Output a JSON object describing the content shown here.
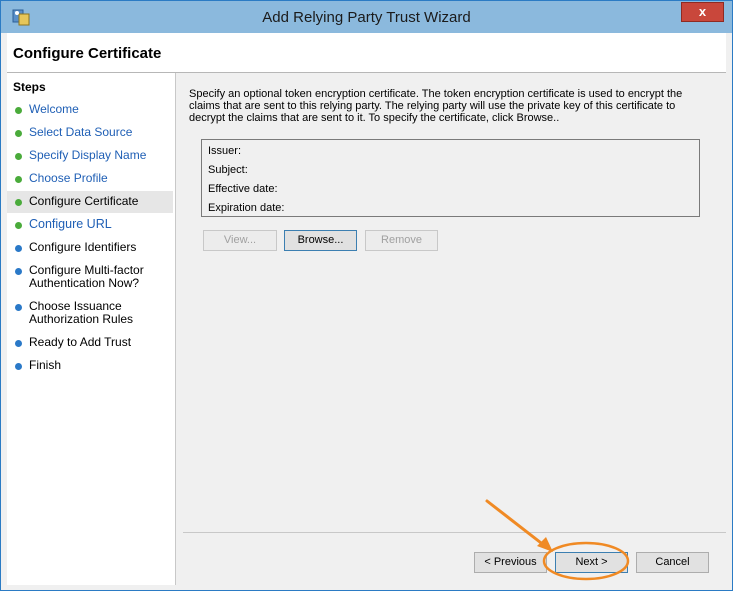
{
  "window": {
    "title": "Add Relying Party Trust Wizard",
    "close_label": "x",
    "icon": "wizard-app-icon"
  },
  "header": {
    "page_title": "Configure Certificate"
  },
  "steps": {
    "title": "Steps",
    "items": [
      {
        "label": "Welcome",
        "status": "complete"
      },
      {
        "label": "Select Data Source",
        "status": "complete"
      },
      {
        "label": "Specify Display Name",
        "status": "complete"
      },
      {
        "label": "Choose Profile",
        "status": "complete"
      },
      {
        "label": "Configure Certificate",
        "status": "current"
      },
      {
        "label": "Configure URL",
        "status": "pending-link"
      },
      {
        "label": "Configure Identifiers",
        "status": "pending"
      },
      {
        "label": "Configure Multi-factor Authentication Now?",
        "status": "pending"
      },
      {
        "label": "Choose Issuance Authorization Rules",
        "status": "pending"
      },
      {
        "label": "Ready to Add Trust",
        "status": "pending"
      },
      {
        "label": "Finish",
        "status": "pending"
      }
    ]
  },
  "content": {
    "description": "Specify an optional token encryption certificate.  The token encryption certificate is used to encrypt the claims that are sent to this relying party.  The relying party will use the private key of this certificate to decrypt the claims that are sent to it.  To specify the certificate, click Browse..",
    "cert_fields": {
      "issuer": "Issuer:",
      "subject": "Subject:",
      "effective_date": "Effective date:",
      "expiration_date": "Expiration date:"
    },
    "buttons": {
      "view": "View...",
      "browse": "Browse...",
      "remove": "Remove"
    }
  },
  "footer": {
    "previous": "< Previous",
    "next": "Next >",
    "cancel": "Cancel"
  },
  "colors": {
    "titlebar": "#8bb9dd",
    "link": "#1f5fb5",
    "complete_dot": "#4aab3b",
    "pending_dot": "#2a79c8",
    "annotation": "#f08a24"
  }
}
